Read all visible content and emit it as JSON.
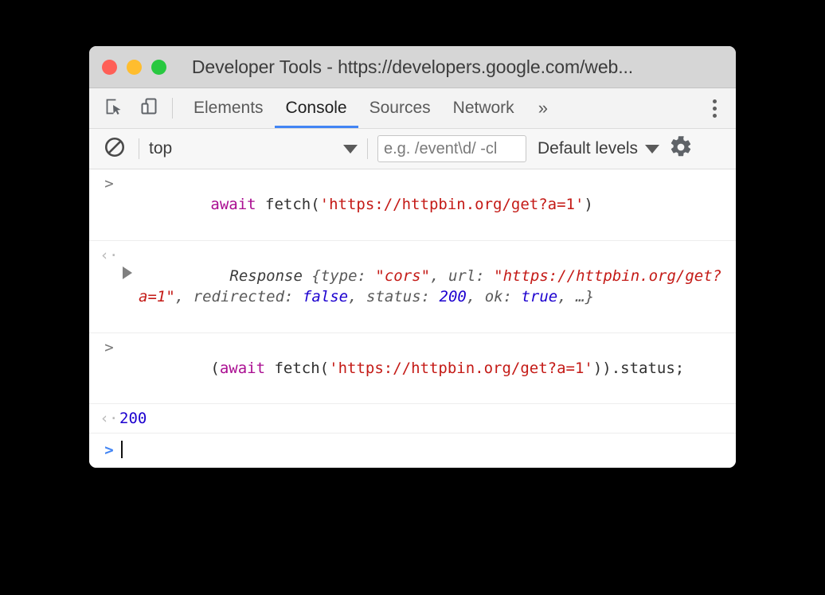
{
  "window": {
    "title": "Developer Tools - https://developers.google.com/web...",
    "traffic_lights": [
      {
        "name": "close",
        "color": "#ff5f57"
      },
      {
        "name": "minimize",
        "color": "#ffbd2e"
      },
      {
        "name": "maximize",
        "color": "#28c840"
      }
    ]
  },
  "tabbar": {
    "inspect_icon": "inspect-element-icon",
    "device_icon": "device-toolbar-icon",
    "tabs": [
      {
        "label": "Elements",
        "active": false
      },
      {
        "label": "Console",
        "active": true
      },
      {
        "label": "Sources",
        "active": false
      },
      {
        "label": "Network",
        "active": false
      }
    ],
    "more_tabs": "»",
    "menu_icon": "more-options-icon",
    "active_underline_color": "#4285f4"
  },
  "console_toolbar": {
    "clear_icon": "clear-console-icon",
    "context": "top",
    "context_caret": "chevron-down-icon",
    "filter_placeholder": "e.g. /event\\d/ -cl",
    "filter_value": "",
    "levels_label": "Default levels",
    "levels_caret": "chevron-down-icon",
    "settings_icon": "gear-icon"
  },
  "console": {
    "input_marker": ">",
    "result_marker": "‹·",
    "messages": [
      {
        "kind": "input",
        "marker": ">",
        "tokens": [
          {
            "t": "await",
            "c": "kw"
          },
          {
            "t": " fetch(",
            "c": "fn"
          },
          {
            "t": "'https://httpbin.org/get?a=1'",
            "c": "str"
          },
          {
            "t": ")",
            "c": "punct"
          }
        ]
      },
      {
        "kind": "result-object",
        "marker": "‹·",
        "expandable": true,
        "tokens": [
          {
            "t": "Response ",
            "c": "cname"
          },
          {
            "t": "{type: ",
            "c": ""
          },
          {
            "t": "\"cors\"",
            "c": "str"
          },
          {
            "t": ", url: ",
            "c": ""
          },
          {
            "t": "\"https://httpbin.org/get?a=1\"",
            "c": "str"
          },
          {
            "t": ", redirected: ",
            "c": ""
          },
          {
            "t": "false",
            "c": "bool"
          },
          {
            "t": ", status: ",
            "c": ""
          },
          {
            "t": "200",
            "c": "num"
          },
          {
            "t": ", ok: ",
            "c": ""
          },
          {
            "t": "true",
            "c": "bool"
          },
          {
            "t": ", …}",
            "c": ""
          }
        ]
      },
      {
        "kind": "input",
        "marker": ">",
        "tokens": [
          {
            "t": "(",
            "c": "punct"
          },
          {
            "t": "await",
            "c": "kw"
          },
          {
            "t": " fetch(",
            "c": "fn"
          },
          {
            "t": "'https://httpbin.org/get?a=1'",
            "c": "str"
          },
          {
            "t": ")).status;",
            "c": "punct"
          }
        ]
      },
      {
        "kind": "result-value",
        "marker": "‹·",
        "value": "200"
      },
      {
        "kind": "prompt",
        "marker": ">",
        "value": ""
      }
    ]
  },
  "colors": {
    "accent": "#4285f4",
    "string": "#c41a16",
    "keyword": "#aa0d91",
    "number": "#1c00cf",
    "titlebar": "#d6d6d6",
    "toolbar": "#f3f3f3",
    "background": "#000000"
  }
}
